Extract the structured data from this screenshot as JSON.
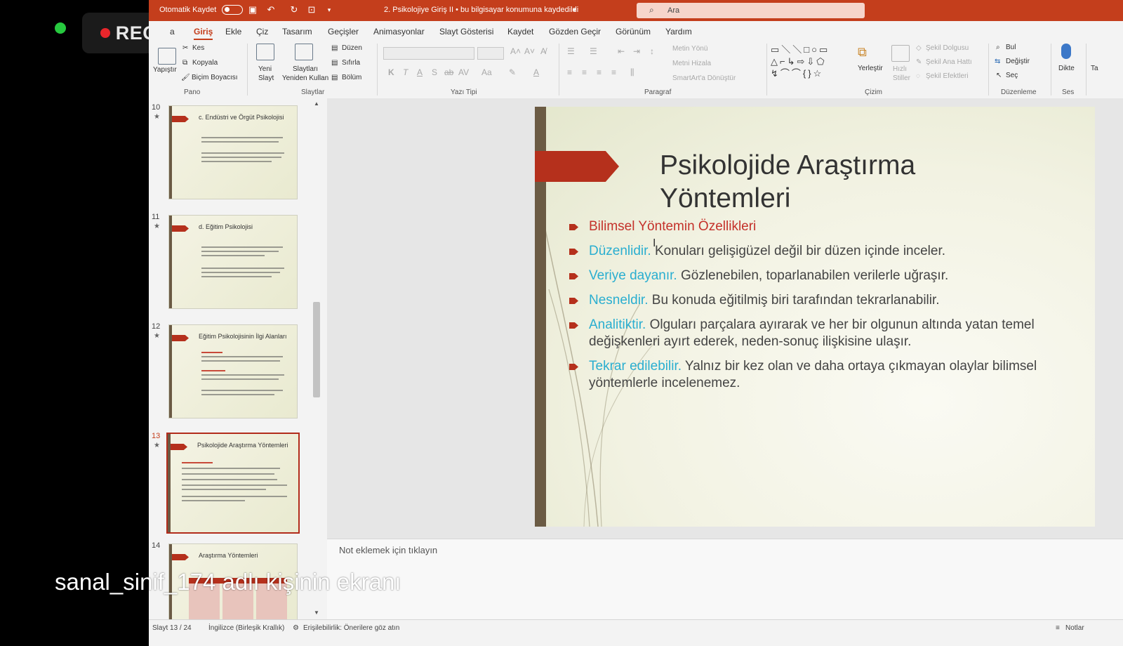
{
  "recording": {
    "label": "REC"
  },
  "titlebar": {
    "autosave_label": "Otomatik Kaydet",
    "doc_title": "2. Psikolojiye Giriş II • bu bilgisayar konumuna kaydedildi",
    "search_placeholder": "Ara",
    "accent": "#c43e1c"
  },
  "menu": [
    "a",
    "Giriş",
    "Ekle",
    "Çiz",
    "Tasarım",
    "Geçişler",
    "Animasyonlar",
    "Slayt Gösterisi",
    "Kaydet",
    "Gözden Geçir",
    "Görünüm",
    "Yardım"
  ],
  "ribbon": {
    "pano": {
      "paste": "Yapıştır",
      "cut": "Kes",
      "copy": "Kopyala",
      "format_painter": "Biçim Boyacısı",
      "group": "Pano"
    },
    "slaytlar": {
      "new_slide": "Yeni Slayt",
      "reuse": "Slaytları Yeniden Kullan",
      "layout": "Düzen",
      "reset": "Sıfırla",
      "section": "Bölüm",
      "group": "Slaytlar"
    },
    "yazi_tipi": {
      "group": "Yazı Tipi"
    },
    "paragraf": {
      "text_direction": "Metin Yönü",
      "align_text": "Metni Hizala",
      "smartart": "SmartArt'a Dönüştür",
      "group": "Paragraf"
    },
    "cizim": {
      "arrange": "Yerleştir",
      "quick_styles": "Hızlı Stiller",
      "fill": "Şekil Dolgusu",
      "outline": "Şekil Ana Hattı",
      "effects": "Şekil Efektleri",
      "group": "Çizim"
    },
    "duzenleme": {
      "find": "Bul",
      "replace": "Değiştir",
      "select": "Seç",
      "group": "Düzenleme"
    },
    "ses": {
      "dictate": "Dikte",
      "group": "Ses"
    },
    "extra": "Ta"
  },
  "thumbnails": [
    {
      "num": "10",
      "title": "c. Endüstri ve Örgüt Psikolojisi"
    },
    {
      "num": "11",
      "title": "d. Eğitim Psikolojisi"
    },
    {
      "num": "12",
      "title": "Eğitim Psikolojisinin İlgi Alanları"
    },
    {
      "num": "13",
      "title": "Psikolojide Araştırma Yöntemleri",
      "selected": true
    },
    {
      "num": "14",
      "title": "Araştırma Yöntemleri"
    }
  ],
  "slide": {
    "title": "Psikolojide Araştırma Yöntemleri",
    "bullets": [
      {
        "term": "Bilimsel Yöntemin Özellikleri",
        "text": ""
      },
      {
        "term": "Düzenlidir.",
        "text": " Konuları gelişigüzel değil bir düzen içinde inceler."
      },
      {
        "term": "Veriye dayanır.",
        "text": " Gözlenebilen, toparlanabilen verilerle uğraşır."
      },
      {
        "term": "Nesneldir.",
        "text": " Bu konuda eğitilmiş biri tarafından tekrarlanabilir."
      },
      {
        "term": "Analitiktir.",
        "text": " Olguları parçalara ayırarak ve her bir olgunun altında yatan temel değişkenleri ayırt ederek, neden-sonuç ilişkisine ulaşır."
      },
      {
        "term": "Tekrar edilebilir.",
        "text": " Yalnız bir kez olan ve daha ortaya çıkmayan olaylar bilimsel yöntemlerle incelenemez."
      }
    ]
  },
  "notes_placeholder": "Not eklemek için tıklayın",
  "status": {
    "slide": "Slayt 13 / 24",
    "language": "İngilizce (Birleşik Krallık)",
    "accessibility": "Erişilebilirlik: Önerilere göz atın",
    "notes": "Notlar"
  },
  "overlay_caption": "sanal_sinif_174 adlı kişinin ekranı"
}
